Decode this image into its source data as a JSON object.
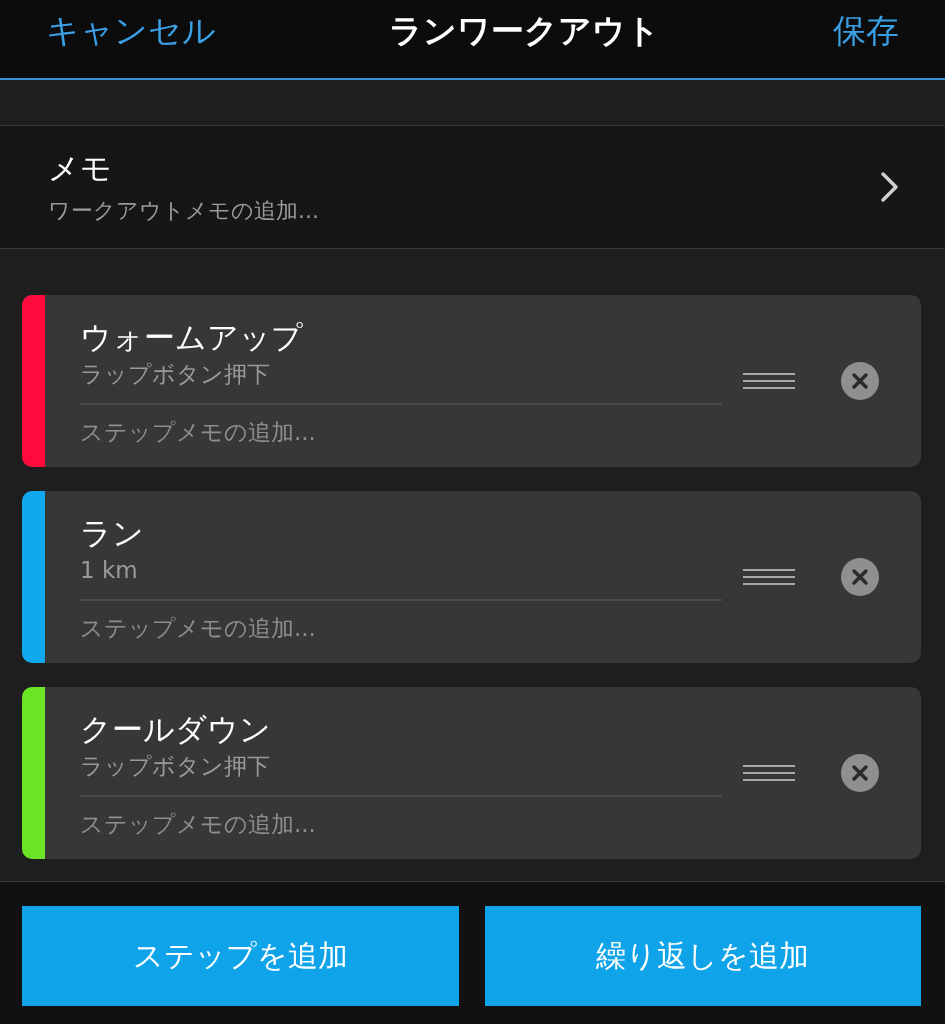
{
  "header": {
    "cancel": "キャンセル",
    "title": "ランワークアウト",
    "save": "保存"
  },
  "memo": {
    "label": "メモ",
    "subtitle": "ワークアウトメモの追加..."
  },
  "steps": [
    {
      "name": "ウォームアップ",
      "detail": "ラップボタン押下",
      "placeholder": "ステップメモの追加...",
      "color": "#ff0a3c"
    },
    {
      "name": "ラン",
      "detail": "1 km",
      "placeholder": "ステップメモの追加...",
      "color": "#10a8ee"
    },
    {
      "name": "クールダウン",
      "detail": "ラップボタン押下",
      "placeholder": "ステップメモの追加...",
      "color": "#6be426"
    }
  ],
  "buttons": [
    "ステップを追加",
    "繰り返しを追加"
  ]
}
